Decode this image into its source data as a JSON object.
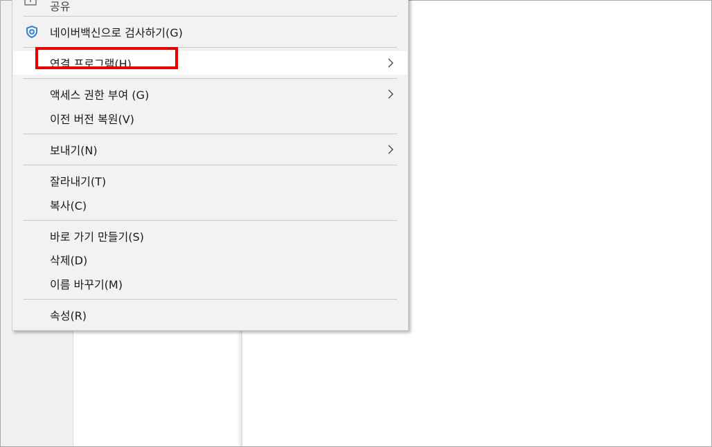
{
  "menu": {
    "partial_top_label": "공유",
    "items": [
      {
        "label": "네이버백신으로 검사하기(G)",
        "icon": "naver-vaccine-shield-icon"
      },
      {
        "label": "연결 프로그램(H)",
        "submenu": true,
        "highlighted": true
      },
      {
        "label": "액세스 권한 부여 (G)",
        "submenu": true
      },
      {
        "label": "이전 버전 복원(V)"
      },
      {
        "label": "보내기(N)",
        "submenu": true
      },
      {
        "label": "잘라내기(T)"
      },
      {
        "label": "복사(C)"
      },
      {
        "label": "바로 가기 만들기(S)"
      },
      {
        "label": "삭제(D)"
      },
      {
        "label": "이름 바꾸기(M)"
      },
      {
        "label": "속성(R)"
      }
    ]
  },
  "colors": {
    "menu_background": "#f2f2f2",
    "hover_background": "#ffffff",
    "highlight_box": "#e50000",
    "shield_icon": "#2f7fd0"
  }
}
